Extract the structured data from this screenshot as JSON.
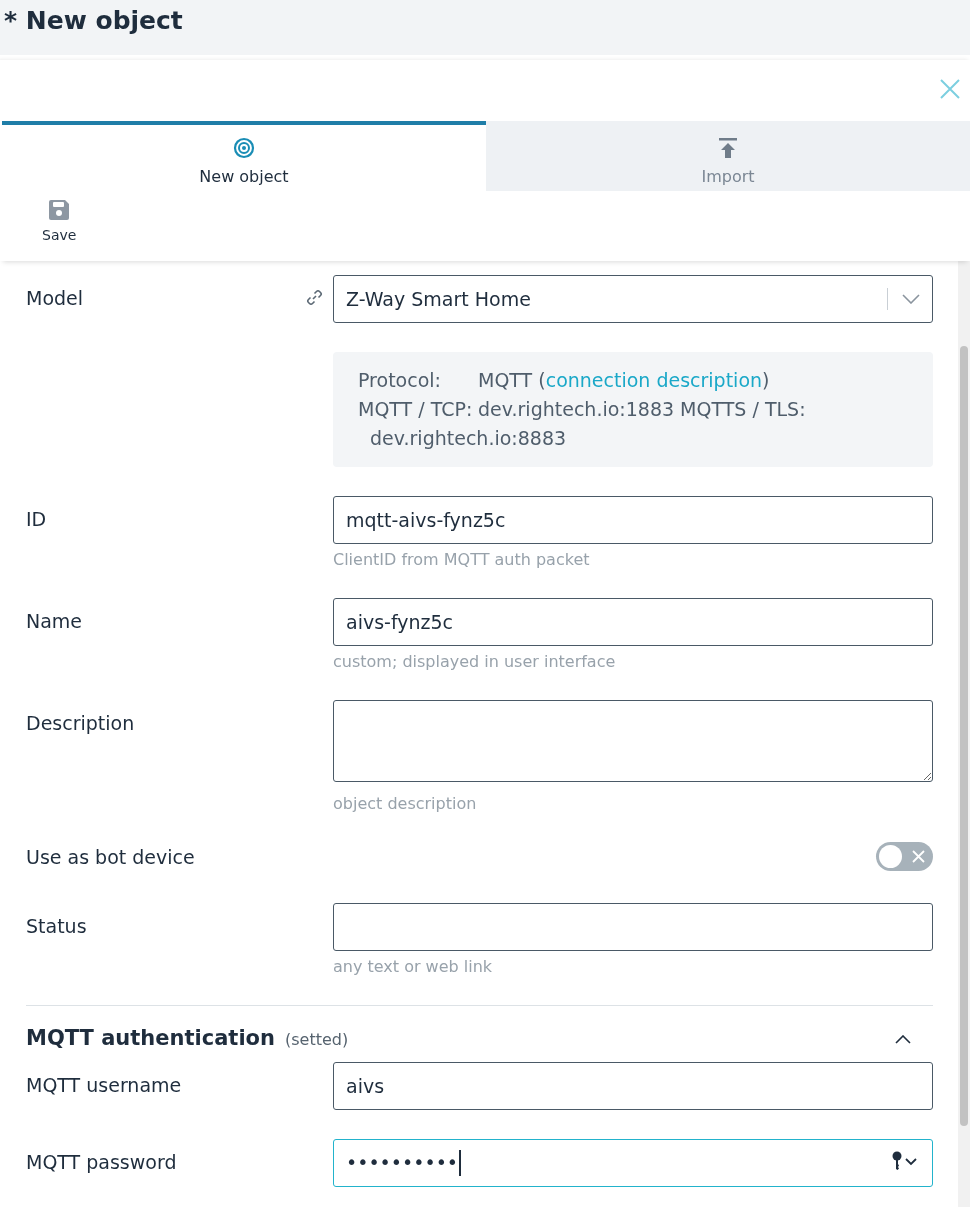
{
  "header": {
    "title": "* New object"
  },
  "tabs": [
    {
      "label": "New object",
      "selected": true
    },
    {
      "label": "Import",
      "selected": false
    }
  ],
  "toolbar": {
    "buttons": [
      {
        "label": "Save"
      }
    ]
  },
  "form": {
    "fields": [
      {
        "kind": "select",
        "label": "Model",
        "value": "Z-Way Smart Home"
      },
      {
        "kind": "info",
        "lines": [
          {
            "label": "Protocol:",
            "before": "MQTT (",
            "link": "connection description",
            "after": ")"
          },
          {
            "label": "MQTT / TCP:",
            "before": "dev.rightech.io:1883 MQTTS / TLS: dev.rightech.io:8883"
          }
        ]
      },
      {
        "kind": "text",
        "label": "ID",
        "value": "mqtt-aivs-fynz5c",
        "hint": "ClientID from MQTT auth packet"
      },
      {
        "kind": "text",
        "label": "Name",
        "value": "aivs-fynz5c",
        "hint": "custom; displayed in user interface"
      },
      {
        "kind": "textarea",
        "label": "Description",
        "hint": "object description"
      },
      {
        "kind": "toggle",
        "label": "Use as bot device",
        "on": false
      },
      {
        "kind": "text",
        "label": "Status",
        "hint": "any text or web link"
      }
    ]
  },
  "section": {
    "title": "MQTT authentication",
    "note": "(setted)",
    "expanded": true,
    "fields": [
      {
        "kind": "text",
        "label": "MQTT username",
        "value": "aivs"
      },
      {
        "kind": "password",
        "label": "MQTT password",
        "value": "••••••••••",
        "focused": true
      }
    ]
  }
}
